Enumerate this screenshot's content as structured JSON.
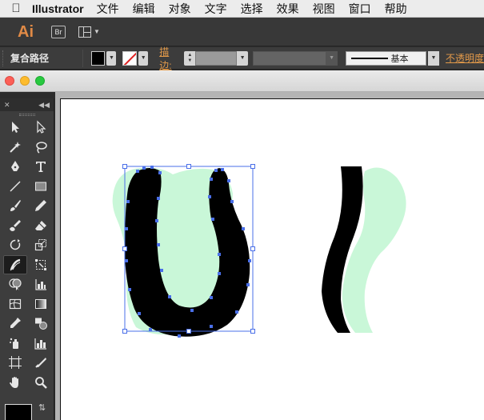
{
  "menubar": {
    "apple_icon": "apple-logo-icon",
    "app_name": "Illustrator",
    "items": [
      "文件",
      "编辑",
      "对象",
      "文字",
      "选择",
      "效果",
      "视图",
      "窗口",
      "帮助"
    ]
  },
  "appbar": {
    "logo_text": "Ai",
    "bridge_label": "Br"
  },
  "control": {
    "selection_type": "复合路径",
    "stroke_label": "描边:",
    "brush_name": "基本",
    "opacity_label": "不透明度"
  },
  "tools": {
    "icons": [
      "selection-tool-icon",
      "direct-selection-tool-icon",
      "magic-wand-tool-icon",
      "lasso-tool-icon",
      "pen-tool-icon",
      "type-tool-icon",
      "line-segment-tool-icon",
      "rectangle-tool-icon",
      "paintbrush-tool-icon",
      "pencil-tool-icon",
      "blob-brush-tool-icon",
      "eraser-tool-icon",
      "rotate-tool-icon",
      "scale-tool-icon",
      "width-tool-icon",
      "free-transform-tool-icon",
      "shape-builder-tool-icon",
      "perspective-grid-tool-icon",
      "mesh-tool-icon",
      "gradient-tool-icon",
      "eyedropper-tool-icon",
      "blend-tool-icon",
      "symbol-sprayer-tool-icon",
      "column-graph-tool-icon",
      "artboard-tool-icon",
      "slice-tool-icon",
      "hand-tool-icon",
      "zoom-tool-icon"
    ],
    "active_tool": "width-tool-icon"
  },
  "colors": {
    "accent_orange": "#e39a4a",
    "selection_blue": "#4a6fe8",
    "mint_shape": "#c9f7d8",
    "fill": "#000000"
  }
}
